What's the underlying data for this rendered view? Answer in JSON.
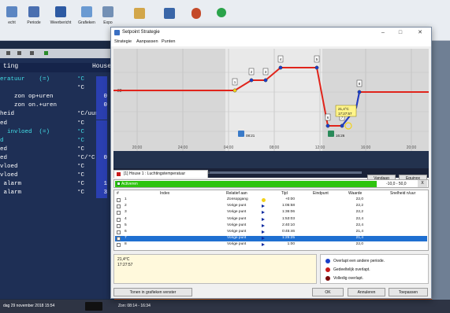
{
  "background_app": {
    "toolbar": [
      "echt",
      "Periode",
      "Weerbericht",
      "Grafieken",
      "Expo"
    ],
    "panel_title_left": "ting",
    "panel_title_right": "House",
    "rows": [
      {
        "label": "eratuur    (=)",
        "unit": "°C",
        "value": "",
        "cyan": true
      },
      {
        "label": "",
        "unit": "°C",
        "value": "",
        "cyan": false
      },
      {
        "label": "    zon op+uren",
        "unit": "",
        "value": "0",
        "cyan": false
      },
      {
        "label": "    zon on.+uren",
        "unit": "",
        "value": "0",
        "cyan": false
      },
      {
        "label": "heid",
        "unit": "°C/uur",
        "value": "",
        "cyan": false
      },
      {
        "label": "ed",
        "unit": "°C",
        "value": "",
        "cyan": false
      },
      {
        "label": "  invloed  (=)",
        "unit": "°C",
        "value": "",
        "cyan": true
      },
      {
        "label": "d",
        "unit": "°C",
        "value": "",
        "cyan": true
      },
      {
        "label": "ed",
        "unit": "°C",
        "value": "",
        "cyan": false
      },
      {
        "label": "ed",
        "unit": "°C/°C",
        "value": "0",
        "cyan": false
      },
      {
        "label": "vloed",
        "unit": "°C",
        "value": "",
        "cyan": false
      },
      {
        "label": "vloed",
        "unit": "°C",
        "value": "",
        "cyan": false
      },
      {
        "label": " alarm",
        "unit": "°C",
        "value": "1",
        "cyan": false
      },
      {
        "label": " alarm",
        "unit": "°C",
        "value": "3",
        "cyan": false
      }
    ],
    "taskbar_left": "dag 29 november 2018  15:54",
    "taskbar_mid": "Zon: 08:14 - 16:34"
  },
  "dialog": {
    "title": "Setpoint Strategie",
    "menu": [
      "Strategie",
      "Aanpassen",
      "Punten"
    ],
    "chart": {
      "y_tick": "22",
      "x_ticks": [
        "20:00",
        "24:00",
        "04:00",
        "08:00",
        "12:00",
        "16:00",
        "20:00"
      ],
      "sunrise_time": "08:21",
      "sunset_time": "16:26",
      "tooltip_line1": "21,4°C",
      "tooltip_line2": "17:27:57",
      "point_labels": [
        "1",
        "2",
        "3",
        "4",
        "5",
        "6",
        "7",
        "8"
      ]
    },
    "date": "29-11-2018",
    "vandaag_label": "Vandaag",
    "equinox_label": "Equinox",
    "tab_label": "[1] House 1 : Luchtingstemperatuur",
    "activeren_label": "Activeren",
    "range_label": "-10,0 - 50,0",
    "range_close": "X",
    "grid_headers": {
      "nr": "#",
      "index": "Index",
      "relatief": "Relatief aan",
      "tijd": "Tijd",
      "eindpunt": "Eindpunt",
      "waarde": "Waarde",
      "snelheid": "Snelheid n/uur"
    },
    "grid_rows": [
      {
        "nr": "1",
        "relatief": "Zonsopgang",
        "tijd": "+0:00",
        "waarde": "22,0",
        "selected": false,
        "marker": "yellow"
      },
      {
        "nr": "2",
        "relatief": "Vorige punt",
        "tijd": "1:05:58",
        "waarde": "22,2",
        "selected": false,
        "marker": "blue"
      },
      {
        "nr": "3",
        "relatief": "Vorige punt",
        "tijd": "1:36:06",
        "waarde": "22,2",
        "selected": false,
        "marker": "blue"
      },
      {
        "nr": "4",
        "relatief": "Vorige punt",
        "tijd": "1:53:03",
        "waarde": "22,4",
        "selected": false,
        "marker": "blue"
      },
      {
        "nr": "5",
        "relatief": "Vorige punt",
        "tijd": "2:40:10",
        "waarde": "22,4",
        "selected": false,
        "marker": "blue"
      },
      {
        "nr": "6",
        "relatief": "Vorige punt",
        "tijd": "0:45:46",
        "waarde": "21,4",
        "selected": false,
        "marker": "blue"
      },
      {
        "nr": "7",
        "relatief": "Vorige punt",
        "tijd": "1:25:25",
        "waarde": "21,4",
        "selected": true,
        "marker": "blue"
      },
      {
        "nr": "8",
        "relatief": "Vorige punt",
        "tijd": "1:00",
        "waarde": "22,0",
        "selected": false,
        "marker": "blue"
      }
    ],
    "note_line1": "21,4°C",
    "note_line2": "17:27:57",
    "legend": [
      {
        "text": "Overlapt een andere periode.",
        "color": "#1a3fc8"
      },
      {
        "text": "Gedeeltelijk overlapt.",
        "color": "#c81a1a"
      },
      {
        "text": "Volledig overlapt.",
        "color": "#7a0a0a"
      }
    ],
    "buttons": {
      "grafieken": "Tonen in grafieken venster",
      "ok": "OK",
      "annuleren": "Annuleren",
      "toepassen": "Toepassen"
    }
  }
}
